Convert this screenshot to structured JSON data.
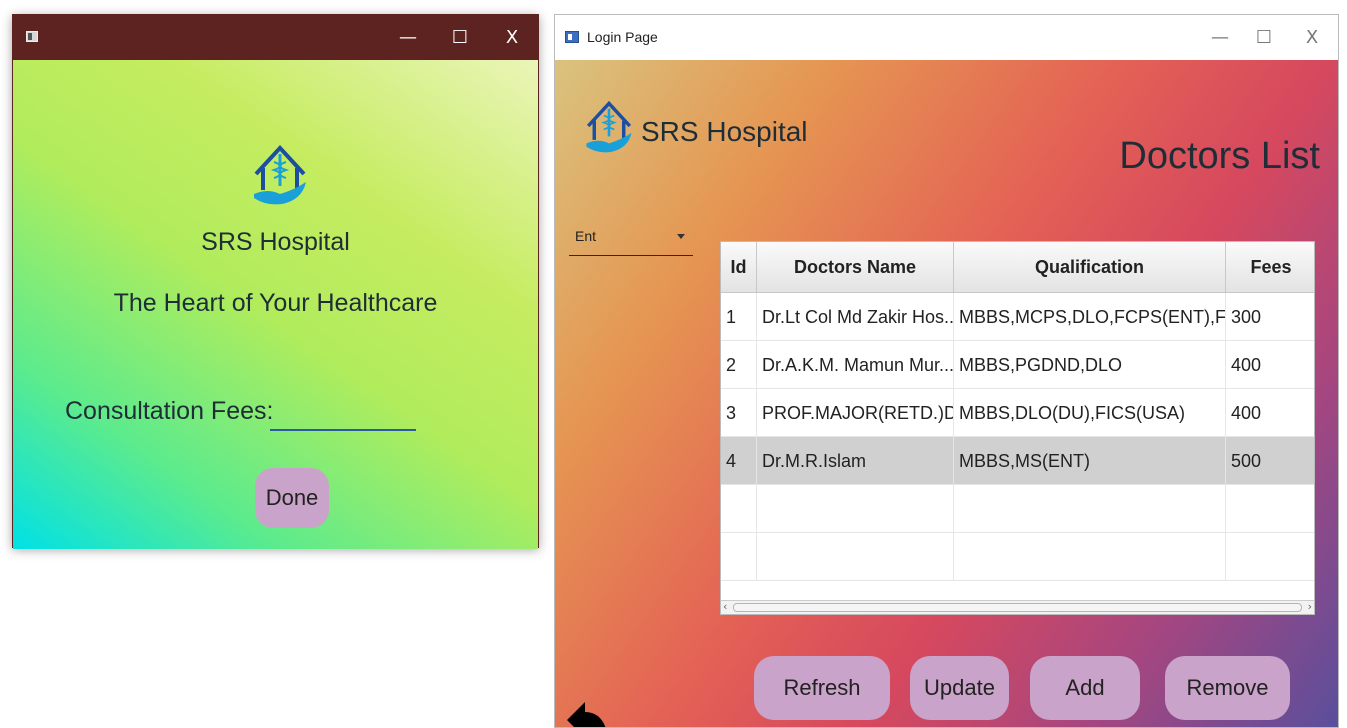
{
  "left_window": {
    "title": "",
    "controls": {
      "minimize": "—",
      "maximize": "☐",
      "close": "X"
    },
    "hospital_name": "SRS Hospital",
    "tagline": "The Heart of Your Healthcare",
    "fees_label": "Consultation Fees:",
    "fees_value": "",
    "done_label": "Done",
    "logo_icon": "hospital-house-caduceus-icon"
  },
  "right_window": {
    "title": "Login Page",
    "controls": {
      "minimize": "—",
      "maximize": "☐",
      "close": "X"
    },
    "hospital_name": "SRS Hospital",
    "heading": "Doctors List",
    "department_select": {
      "value": "Ent"
    },
    "table": {
      "columns": [
        "Id",
        "Doctors Name",
        "Qualification",
        "Fees"
      ],
      "rows": [
        {
          "id": "1",
          "name": "Dr.Lt Col Md Zakir Hos...",
          "qualification": "MBBS,MCPS,DLO,FCPS(ENT),FA...",
          "fees": "300"
        },
        {
          "id": "2",
          "name": "Dr.A.K.M. Mamun Mur...",
          "qualification": "MBBS,PGDND,DLO",
          "fees": "400"
        },
        {
          "id": "3",
          "name": "PROF.MAJOR(RETD.)D...",
          "qualification": "MBBS,DLO(DU),FICS(USA)",
          "fees": "400"
        },
        {
          "id": "4",
          "name": "Dr.M.R.Islam",
          "qualification": "MBBS,MS(ENT)",
          "fees": "500"
        }
      ],
      "selected_row": 4
    },
    "buttons": {
      "refresh": "Refresh",
      "update": "Update",
      "add": "Add",
      "remove": "Remove"
    },
    "back_icon": "back-arrow-icon"
  },
  "colors": {
    "left_titlebar": "#5c2320",
    "button_bg": "#c9a3c9",
    "text": "#1f2d36",
    "logo_blue": "#1d4fa0",
    "logo_teal": "#1aa0d8"
  }
}
